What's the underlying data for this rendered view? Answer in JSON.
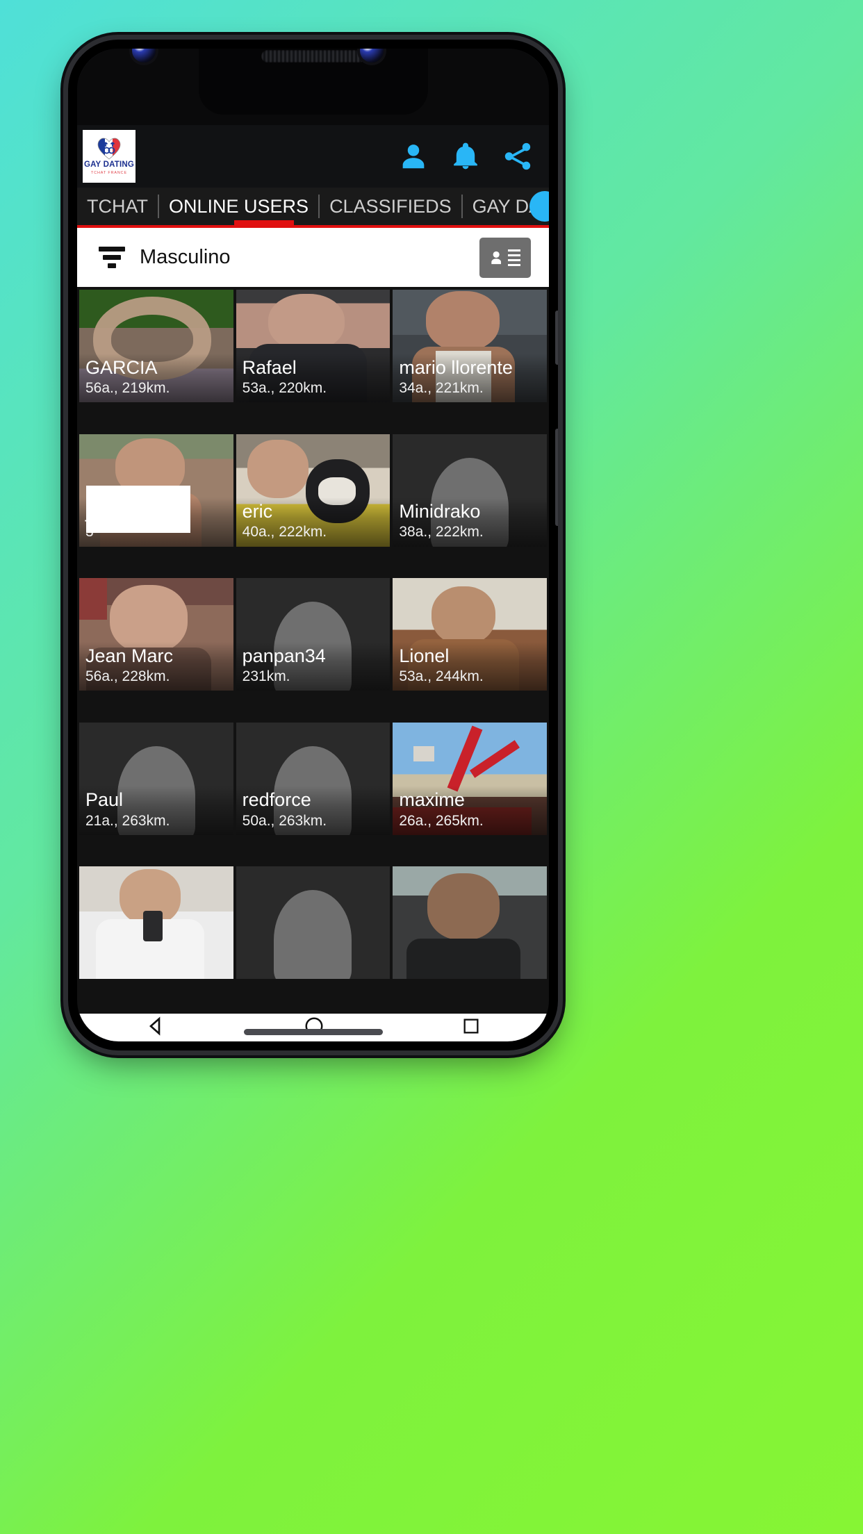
{
  "app": {
    "logo": {
      "title": "GAY DATING",
      "subtitle": "TCHAT FRANCE",
      "icon": "french-flag-heart-logo"
    },
    "header_icons": [
      {
        "name": "profile-icon",
        "glyph": "person"
      },
      {
        "name": "notifications-bell-icon",
        "glyph": "bell"
      },
      {
        "name": "share-icon",
        "glyph": "share"
      }
    ]
  },
  "tabs": [
    {
      "label": "TCHAT",
      "active": false
    },
    {
      "label": "ONLINE USERS",
      "active": true
    },
    {
      "label": "CLASSIFIEDS",
      "active": false
    },
    {
      "label": "GAY DATING",
      "active": false
    }
  ],
  "filter_bar": {
    "filter_icon": "sort-filter-icon",
    "selected_value": "Masculino",
    "list_button_icon": "contact-list-icon"
  },
  "users": [
    {
      "name": "GARCIA",
      "detail": "56a., 219km.",
      "has_photo": true,
      "photo": "heart-topiary"
    },
    {
      "name": "Rafael",
      "detail": "53a., 220km.",
      "has_photo": true,
      "photo": "man-portrait"
    },
    {
      "name": "mario llorente",
      "detail": "34a., 221km.",
      "has_photo": true,
      "photo": "man-tank-top"
    },
    {
      "name": "j",
      "detail": "3",
      "has_photo": true,
      "photo": "man-beard",
      "covered": true
    },
    {
      "name": "eric",
      "detail": "40a., 222km.",
      "has_photo": true,
      "photo": "man-with-dog"
    },
    {
      "name": "Minidrako",
      "detail": "38a., 222km.",
      "has_photo": false,
      "photo": ""
    },
    {
      "name": "Jean Marc",
      "detail": "56a., 228km.",
      "has_photo": true,
      "photo": "man-indoor"
    },
    {
      "name": "panpan34",
      "detail": "231km.",
      "has_photo": false,
      "photo": ""
    },
    {
      "name": "Lionel",
      "detail": "53a., 244km.",
      "has_photo": true,
      "photo": "bald-man"
    },
    {
      "name": "Paul",
      "detail": "21a., 263km.",
      "has_photo": false,
      "photo": ""
    },
    {
      "name": "redforce",
      "detail": "50a., 263km.",
      "has_photo": false,
      "photo": ""
    },
    {
      "name": "maxime",
      "detail": "26a., 265km.",
      "has_photo": true,
      "photo": "crane-truck"
    },
    {
      "name": "",
      "detail": "",
      "has_photo": true,
      "photo": "man-selfie",
      "partial": true
    },
    {
      "name": "",
      "detail": "",
      "has_photo": false,
      "photo": "",
      "partial": true
    },
    {
      "name": "",
      "detail": "",
      "has_photo": true,
      "photo": "man-dark-portrait",
      "partial": true
    }
  ],
  "navbar": [
    {
      "name": "back-button",
      "glyph": "triangle-left"
    },
    {
      "name": "home-button",
      "glyph": "circle"
    },
    {
      "name": "recents-button",
      "glyph": "square"
    }
  ],
  "colors": {
    "accent_blue": "#29b6f6",
    "accent_red": "#e01010",
    "header_bg": "#111214",
    "grid_bg": "#121212"
  }
}
